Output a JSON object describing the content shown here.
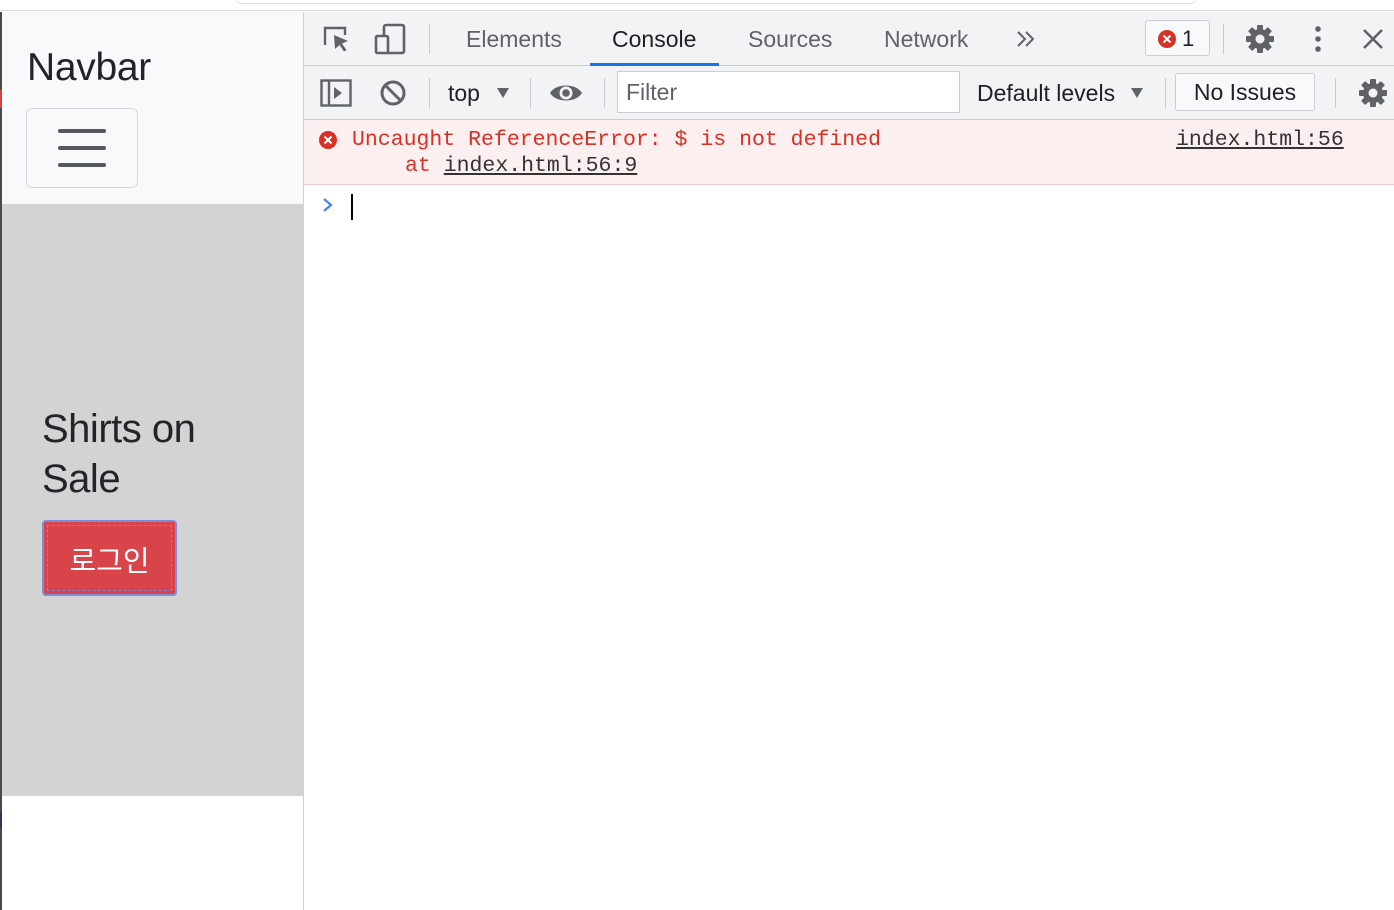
{
  "page": {
    "brand": "Navbar",
    "hero_title": "Shirts on Sale",
    "login_button": "로그인"
  },
  "devtools": {
    "tabs": [
      "Elements",
      "Console",
      "Sources",
      "Network"
    ],
    "active_tab": "Console",
    "error_count": "1",
    "context": "top",
    "filter_placeholder": "Filter",
    "levels": "Default levels",
    "issues": "No Issues"
  },
  "console": {
    "error_message": "Uncaught ReferenceError: $ is not defined",
    "error_at_prefix": "at ",
    "error_at_link": "index.html:56:9",
    "error_source": "index.html:56"
  },
  "icons": [
    "inspect-element-icon",
    "device-toggle-icon",
    "more-tabs-icon",
    "error-icon",
    "settings-gear-icon",
    "kebab-menu-icon",
    "close-icon",
    "sidebar-toggle-icon",
    "clear-console-icon",
    "dropdown-arrow-icon",
    "live-expression-eye-icon",
    "console-settings-gear-icon",
    "prompt-chevron-icon"
  ],
  "colors": {
    "error_text": "#d93025",
    "error_bg": "#fcefef",
    "active_tab_underline": "#1a73e8",
    "login_button": "#d9434a",
    "hero_bg": "#d3d3d3",
    "navbar_bg": "#f8f9fa"
  }
}
